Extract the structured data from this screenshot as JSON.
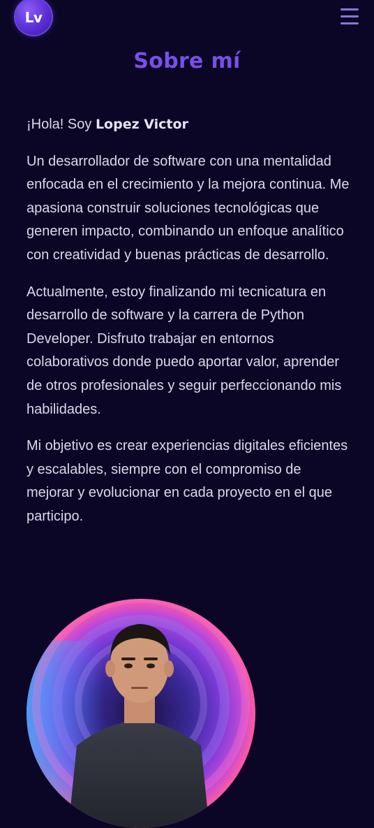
{
  "header": {
    "logo_text": "Lv",
    "menu_icon": "hamburger-menu-icon",
    "accent_color": "#7a4fe8"
  },
  "about": {
    "title": "Sobre mí",
    "greeting_prefix": "¡Hola! Soy ",
    "name": "Lopez Victor",
    "paragraphs": [
      "Un desarrollador de software con una mentalidad enfocada en el crecimiento y la mejora continua. Me apasiona construir soluciones tecnológicas que generen impacto, combinando un enfoque analítico con creatividad y buenas prácticas de desarrollo.",
      "Actualmente, estoy finalizando mi tecnicatura en desarrollo de software y la carrera de Python Developer. Disfruto trabajar en entornos colaborativos donde puedo aportar valor, aprender de otros profesionales y seguir perfeccionando mis habilidades.",
      "Mi objetivo es crear experiencias digitales eficientes y escalables, siempre con el compromiso de mejorar y evolucionar en cada proyecto en el que participo."
    ]
  }
}
